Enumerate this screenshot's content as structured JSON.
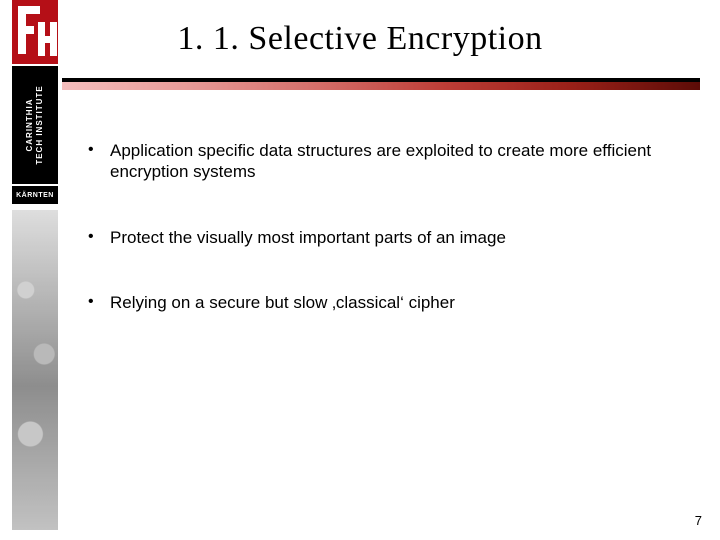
{
  "header": {
    "title": "1. 1. Selective Encryption"
  },
  "sidebar": {
    "institute_line1": "CARINTHIA",
    "institute_line2": "TECH INSTITUTE",
    "region_label": "KÄRNTEN"
  },
  "bullets": [
    "Application specific data structures are exploited to create more efficient encryption systems",
    "Protect the visually most important parts of an image",
    "Relying on a secure but slow ‚classical‘ cipher"
  ],
  "page_number": "7",
  "colors": {
    "brand_red": "#b50f17",
    "rule_gradient_from": "#f4bdbc",
    "rule_gradient_to": "#5c0c07"
  }
}
